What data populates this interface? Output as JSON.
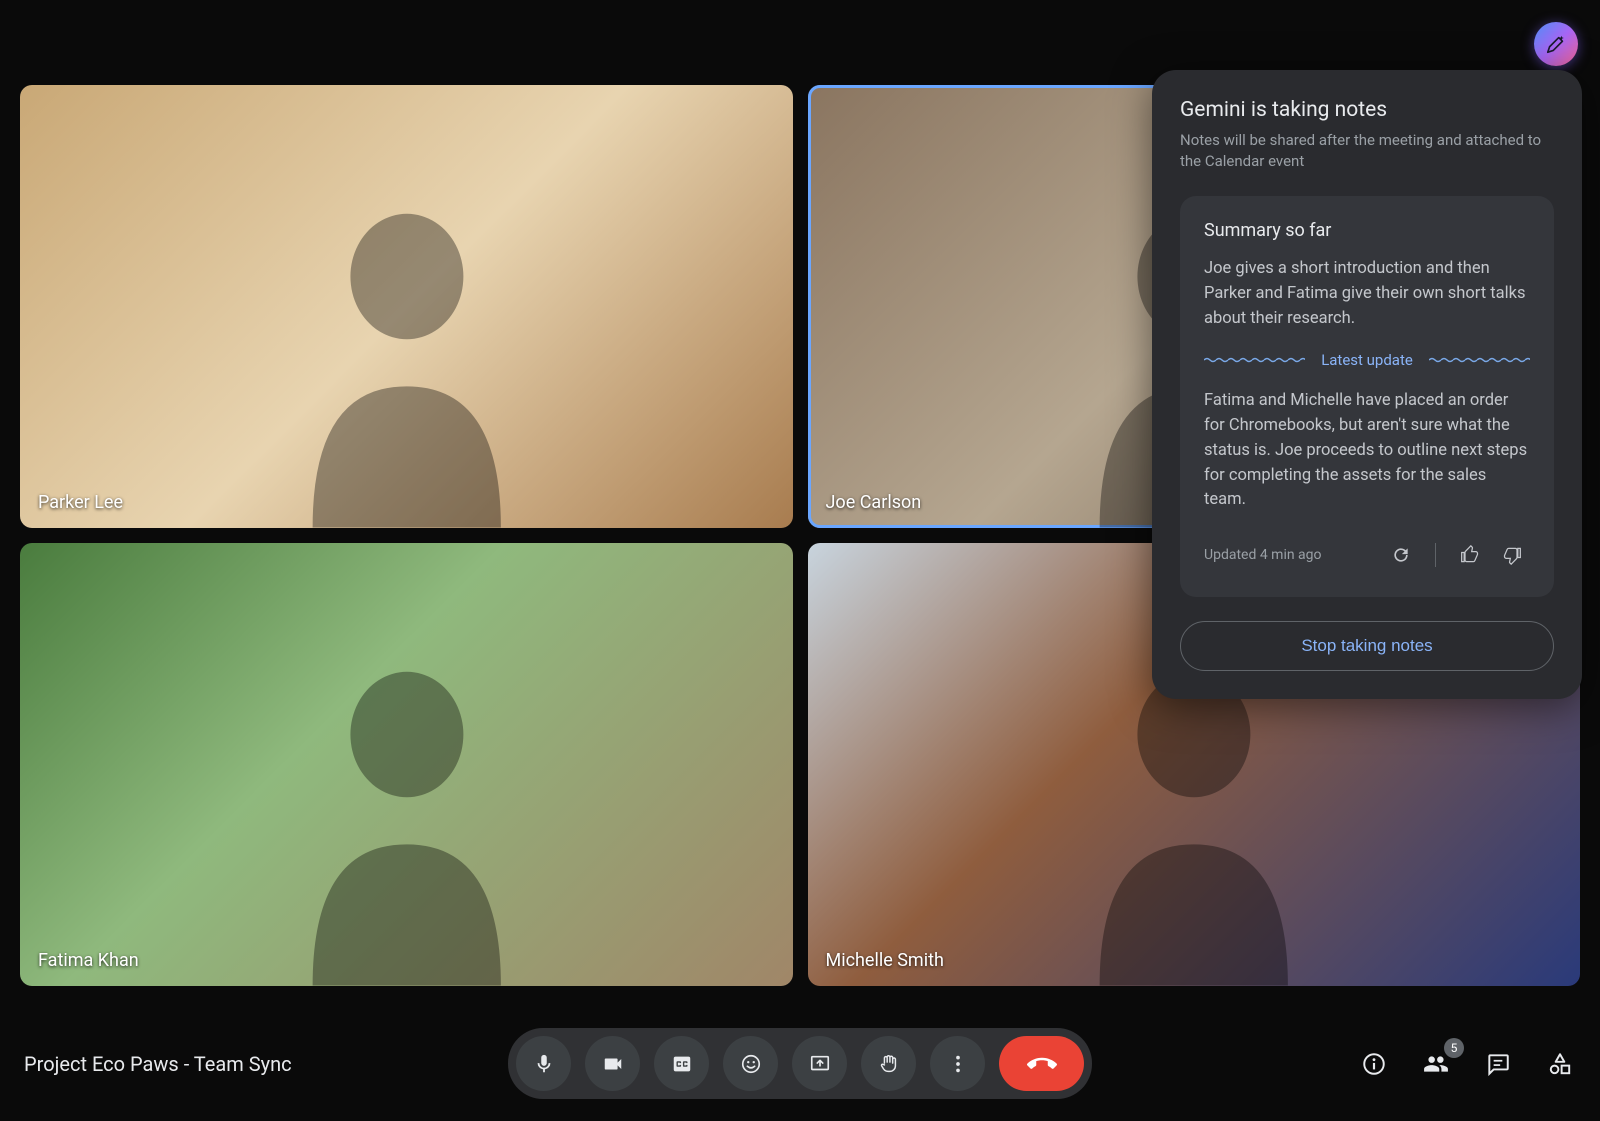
{
  "meeting": {
    "title": "Project Eco Paws - Team Sync",
    "participants": [
      {
        "name": "Parker Lee",
        "active_speaker": false
      },
      {
        "name": "Joe Carlson",
        "active_speaker": true
      },
      {
        "name": "Fatima Khan",
        "active_speaker": false
      },
      {
        "name": "Michelle Smith",
        "active_speaker": false
      }
    ],
    "participant_count": "5"
  },
  "gemini_panel": {
    "title": "Gemini is taking notes",
    "subtitle": "Notes will be shared after the meeting and attached to the Calendar event",
    "summary_heading": "Summary so far",
    "summary_intro": "Joe gives a short introduction and then Parker and Fatima give their own short talks about their research.",
    "latest_update_label": "Latest update",
    "latest_update_text": "Fatima and Michelle have placed an order for Chromebooks, but aren't sure what the status is. Joe proceeds to outline next steps for completing the assets for the sales team.",
    "updated_label": "Updated 4 min ago",
    "stop_label": "Stop taking notes"
  },
  "controls": {
    "mic": "microphone",
    "camera": "camera",
    "captions": "closed-captions",
    "emoji": "reactions",
    "present": "present-screen",
    "raise_hand": "raise-hand",
    "more": "more-options",
    "end": "leave-call",
    "info": "meeting-info",
    "people": "participants",
    "chat": "chat",
    "activities": "activities"
  }
}
